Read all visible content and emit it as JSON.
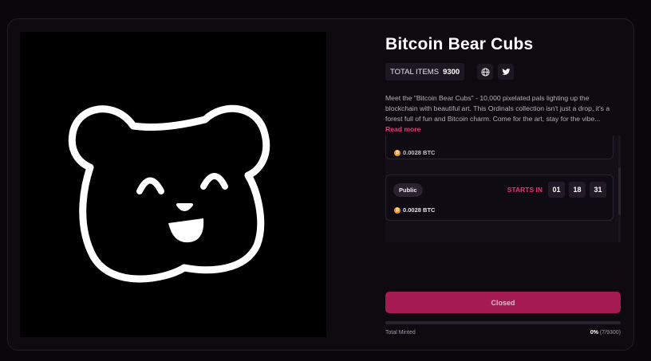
{
  "collection": {
    "title": "Bitcoin Bear Cubs",
    "total_items_label": "TOTAL ITEMS",
    "total_items_value": "9300",
    "description": "Meet the \"Bitcoin Bear Cubs\" - 10,000 pixelated pals lighting up the blockchain with beautiful art. This Ordinals collection isn't just a drop, it's a forest full of fun and Bitcoin charm. Come for the art, stay for the vibe...",
    "read_more": "Read more",
    "icons": {
      "website": "globe-icon",
      "twitter": "twitter-icon"
    }
  },
  "phases": [
    {
      "price": "0.0028 BTC"
    },
    {
      "stage": "Public",
      "price": "0.0028 BTC",
      "starts_label": "STARTS IN",
      "countdown": [
        "01",
        "18",
        "31"
      ]
    }
  ],
  "mint": {
    "button_label": "Closed",
    "total_minted_label": "Total Minted",
    "percent": "0%",
    "count": "(7/9300)",
    "progress": 0
  },
  "colors": {
    "accent": "#a61b54",
    "accent_text": "#e83a7d",
    "background": "#0a070c",
    "card": "#0e0a10"
  }
}
